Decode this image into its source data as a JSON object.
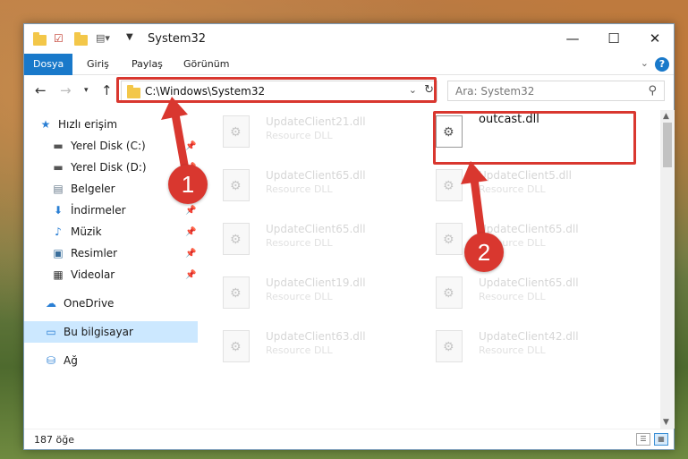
{
  "window": {
    "title": "System32",
    "controls": {
      "minimize": "—",
      "maximize": "☐",
      "close": "✕"
    }
  },
  "ribbon": {
    "tabs": [
      {
        "label": "Dosya",
        "active": true
      },
      {
        "label": "Giriş"
      },
      {
        "label": "Paylaş"
      },
      {
        "label": "Görünüm"
      }
    ],
    "help": "?"
  },
  "nav": {
    "address": "C:\\Windows\\System32",
    "search_placeholder": "Ara: System32"
  },
  "sidebar": {
    "items": [
      {
        "label": "Hızlı erişim",
        "icon": "star-icon",
        "glyph": "★"
      },
      {
        "label": "Yerel Disk (C:)",
        "icon": "drive-icon",
        "glyph": "▬",
        "pinned": true
      },
      {
        "label": "Yerel Disk (D:)",
        "icon": "drive-icon",
        "glyph": "▬",
        "pinned": true
      },
      {
        "label": "Belgeler",
        "icon": "documents-icon",
        "glyph": "▤",
        "pinned": true
      },
      {
        "label": "İndirmeler",
        "icon": "downloads-icon",
        "glyph": "⬇",
        "pinned": true
      },
      {
        "label": "Müzik",
        "icon": "music-icon",
        "glyph": "♪",
        "pinned": true
      },
      {
        "label": "Resimler",
        "icon": "pictures-icon",
        "glyph": "▣",
        "pinned": true
      },
      {
        "label": "Videolar",
        "icon": "videos-icon",
        "glyph": "▦",
        "pinned": true
      },
      {
        "label": "OneDrive",
        "icon": "onedrive-icon",
        "glyph": "☁"
      },
      {
        "label": "Bu bilgisayar",
        "icon": "computer-icon",
        "glyph": "▭",
        "selected": true
      },
      {
        "label": "Ağ",
        "icon": "network-icon",
        "glyph": "⛁"
      }
    ]
  },
  "files": {
    "left": [
      {
        "name": "UpdateClient21.dll",
        "type": "Resource DLL"
      },
      {
        "name": "UpdateClient65.dll",
        "type": "Resource DLL"
      },
      {
        "name": "UpdateClient65.dll",
        "type": "Resource DLL"
      },
      {
        "name": "UpdateClient19.dll",
        "type": "Resource DLL"
      },
      {
        "name": "UpdateClient63.dll",
        "type": "Resource DLL"
      }
    ],
    "right": [
      {
        "name": "outcast.dll",
        "type": "",
        "highlight": true
      },
      {
        "name": "UpdateClient5.dll",
        "type": "Resource DLL"
      },
      {
        "name": "UpdateClient65.dll",
        "type": "Resource DLL"
      },
      {
        "name": "UpdateClient65.dll",
        "type": "Resource DLL"
      },
      {
        "name": "UpdateClient42.dll",
        "type": "Resource DLL"
      }
    ]
  },
  "status": {
    "count": "187 öğe"
  },
  "annotations": {
    "step1": "1",
    "step2": "2",
    "color": "#d9372f"
  }
}
